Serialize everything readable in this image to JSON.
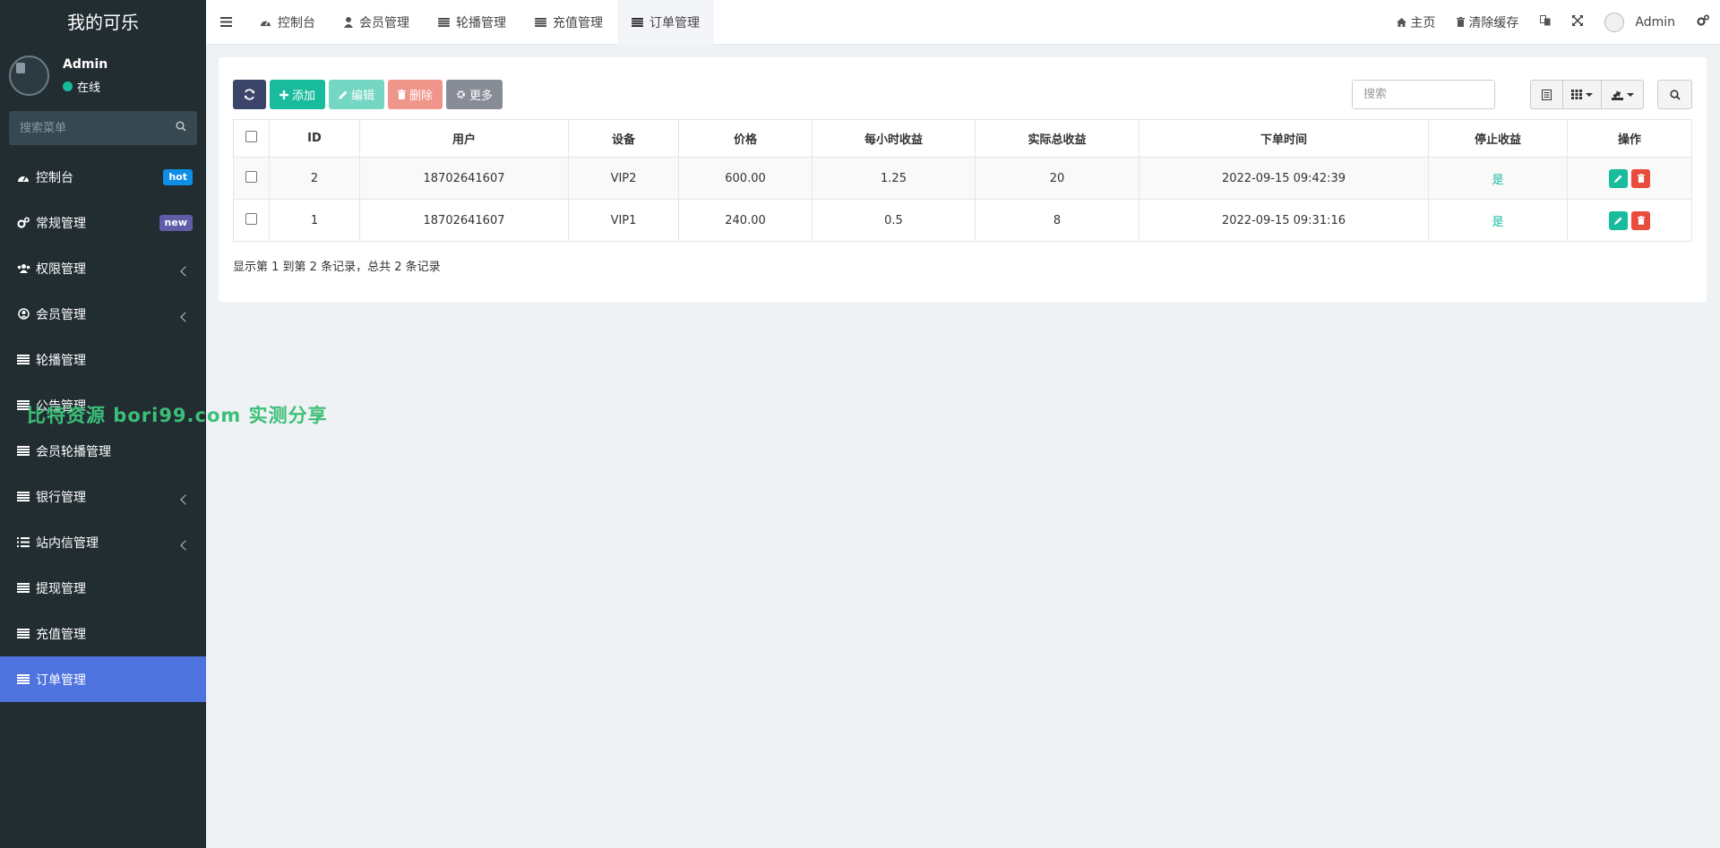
{
  "sidebar": {
    "logo": "我的可乐",
    "user_name": "Admin",
    "user_status": "在线",
    "search_placeholder": "搜索菜单",
    "items": [
      {
        "label": "控制台",
        "icon": "dashboard-icon",
        "badge": "hot"
      },
      {
        "label": "常规管理",
        "icon": "cogs-icon",
        "badge": "new"
      },
      {
        "label": "权限管理",
        "icon": "group-icon",
        "expandable": true
      },
      {
        "label": "会员管理",
        "icon": "user-circle-icon",
        "expandable": true
      },
      {
        "label": "轮播管理",
        "icon": "list-icon"
      },
      {
        "label": "公告管理",
        "icon": "list-icon"
      },
      {
        "label": "会员轮播管理",
        "icon": "list-icon"
      },
      {
        "label": "银行管理",
        "icon": "list-icon",
        "expandable": true
      },
      {
        "label": "站内信管理",
        "icon": "list-ul-icon",
        "expandable": true
      },
      {
        "label": "提现管理",
        "icon": "list-icon"
      },
      {
        "label": "充值管理",
        "icon": "list-icon"
      },
      {
        "label": "订单管理",
        "icon": "list-icon",
        "active": true
      }
    ]
  },
  "watermark": "比特资源 bori99.com 实测分享",
  "header": {
    "tabs": [
      {
        "label": "控制台",
        "icon": "dashboard-icon"
      },
      {
        "label": "会员管理",
        "icon": "user-icon"
      },
      {
        "label": "轮播管理",
        "icon": "list-icon"
      },
      {
        "label": "充值管理",
        "icon": "list-icon"
      },
      {
        "label": "订单管理",
        "icon": "list-icon",
        "active": true
      }
    ],
    "home_label": "主页",
    "clear_cache_label": "清除缓存",
    "admin_label": "Admin"
  },
  "toolbar": {
    "add_label": "添加",
    "edit_label": "编辑",
    "delete_label": "删除",
    "more_label": "更多",
    "search_placeholder": "搜索"
  },
  "table": {
    "columns": [
      "ID",
      "用户",
      "设备",
      "价格",
      "每小时收益",
      "实际总收益",
      "下单时间",
      "停止收益",
      "操作"
    ],
    "rows": [
      {
        "id": "2",
        "user": "18702641607",
        "device": "VIP2",
        "price": "600.00",
        "hourly": "1.25",
        "total": "20",
        "time": "2022-09-15 09:42:39",
        "stopped": "是"
      },
      {
        "id": "1",
        "user": "18702641607",
        "device": "VIP1",
        "price": "240.00",
        "hourly": "0.5",
        "total": "8",
        "time": "2022-09-15 09:31:16",
        "stopped": "是"
      }
    ]
  },
  "pager_info": "显示第 1 到第 2 条记录，总共 2 条记录",
  "colors": {
    "sidebar_bg": "#222d32",
    "active_menu": "#4e73df",
    "success": "#18bc9c",
    "danger": "#e74c3c"
  }
}
